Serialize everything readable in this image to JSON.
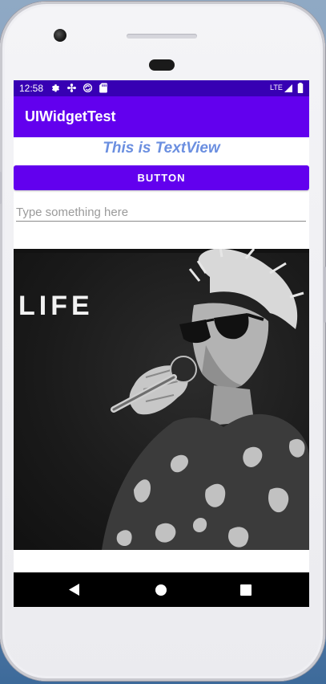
{
  "status_bar": {
    "time": "12:58",
    "network": "LTE",
    "left_icons": [
      "gear-icon",
      "fan-icon",
      "sync-icon",
      "sd-card-icon"
    ],
    "right_icons": [
      "signal-icon",
      "battery-icon"
    ]
  },
  "app_bar": {
    "title": "UIWidgetTest"
  },
  "text_view": {
    "text": "This is TextView"
  },
  "button": {
    "label": "BUTTON"
  },
  "edit_text": {
    "placeholder": "Type something here",
    "value": ""
  },
  "image_view": {
    "text": "LIFE"
  },
  "nav_bar": {
    "buttons": [
      "back-icon",
      "home-icon",
      "recents-icon"
    ]
  },
  "colors": {
    "primary": "#6200ee",
    "primary_dark": "#3700b3",
    "text_view": "#6b8fe0",
    "nav_bar": "#000000"
  }
}
